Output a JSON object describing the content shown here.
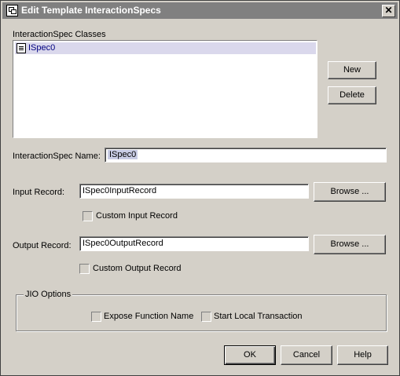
{
  "window": {
    "title": "Edit Template InteractionSpecs",
    "close_glyph": "✕"
  },
  "classes": {
    "label": "InteractionSpec Classes",
    "items": [
      {
        "label": "ISpec0",
        "icon": "document-icon"
      }
    ]
  },
  "buttons": {
    "new": "New",
    "delete": "Delete",
    "browse_input": "Browse ...",
    "browse_output": "Browse ...",
    "ok": "OK",
    "cancel": "Cancel",
    "help": "Help"
  },
  "spec_name": {
    "label": "InteractionSpec Name:",
    "value": "ISpec0"
  },
  "input_record": {
    "label": "Input Record:",
    "value": "ISpec0InputRecord",
    "custom_label": "Custom Input Record",
    "custom_checked": false
  },
  "output_record": {
    "label": "Output Record:",
    "value": "ISpec0OutputRecord",
    "custom_label": "Custom Output Record",
    "custom_checked": false
  },
  "jio_options": {
    "legend": "JIO Options",
    "expose_function_name": "Expose Function Name",
    "start_local_transaction": "Start Local Transaction"
  },
  "colors": {
    "title_inactive": "#808080",
    "face": "#d4d0c8",
    "selection": "#dad8ec"
  }
}
